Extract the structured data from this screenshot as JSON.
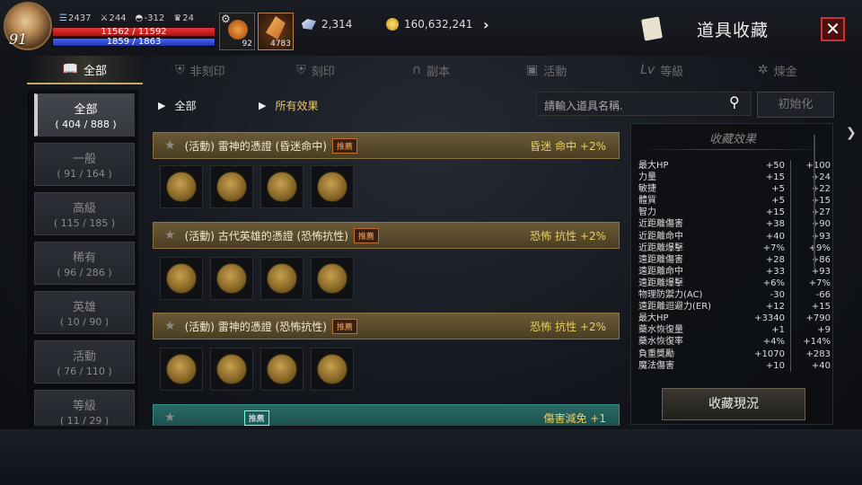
{
  "player": {
    "level": "91",
    "stat1": "2437",
    "stat2": "244",
    "stat3": "-312",
    "stat4": "24",
    "hp": "11562 / 11592",
    "mp": "1859 / 1863"
  },
  "slots": {
    "potion_count": "92",
    "feather_count": "4783"
  },
  "currency": {
    "crystal": "2,314",
    "gold": "160,632,241"
  },
  "window": {
    "title": "道具收藏",
    "close": "✕"
  },
  "tabs": [
    {
      "label": "全部",
      "icon": "book-icon"
    },
    {
      "label": "非刻印",
      "icon": "shield-icon"
    },
    {
      "label": "刻印",
      "icon": "shield-icon"
    },
    {
      "label": "副本",
      "icon": "portal-icon"
    },
    {
      "label": "活動",
      "icon": "gift-icon"
    },
    {
      "label": "等級",
      "icon": "level-icon"
    },
    {
      "label": "煉金",
      "icon": "alchemy-icon"
    }
  ],
  "nav": [
    {
      "label": "全部",
      "count": "( 404 / 888 )"
    },
    {
      "label": "一般",
      "count": "( 91 / 164 )"
    },
    {
      "label": "高級",
      "count": "( 115 / 185 )"
    },
    {
      "label": "稀有",
      "count": "( 96 / 286 )"
    },
    {
      "label": "英雄",
      "count": "( 10 / 90 )"
    },
    {
      "label": "活動",
      "count": "( 76 / 110 )"
    },
    {
      "label": "等級",
      "count": "( 11 / 29 )"
    }
  ],
  "filter": {
    "category": "全部",
    "effect": "所有效果",
    "search_placeholder": "請輸入道具名稱.",
    "reset": "初始化"
  },
  "collections": [
    {
      "name": "(活動) 雷神的憑證 (昏迷命中)",
      "badge": "推薦",
      "effect": "昏迷 命中 +2%"
    },
    {
      "name": "(活動) 古代英雄的憑證 (恐怖抗性)",
      "badge": "推薦",
      "effect": "恐怖 抗性 +2%"
    },
    {
      "name": "(活動) 雷神的憑證 (恐怖抗性)",
      "badge": "推薦",
      "effect": "恐怖 抗性 +2%"
    },
    {
      "name": "",
      "badge": "推薦",
      "effect": "傷害減免 +1"
    }
  ],
  "effects_panel": {
    "title": "收藏效果",
    "button": "收藏現況",
    "rows": [
      {
        "k": "最大HP",
        "a": "+50",
        "b": "+100"
      },
      {
        "k": "力量",
        "a": "+15",
        "b": "+24"
      },
      {
        "k": "敏捷",
        "a": "+5",
        "b": "+22"
      },
      {
        "k": "體質",
        "a": "+5",
        "b": "+15"
      },
      {
        "k": "智力",
        "a": "+15",
        "b": "+27"
      },
      {
        "k": "近距離傷害",
        "a": "+38",
        "b": "+90"
      },
      {
        "k": "近距離命中",
        "a": "+40",
        "b": "+93"
      },
      {
        "k": "近距離爆擊",
        "a": "+7%",
        "b": "+9%"
      },
      {
        "k": "遠距離傷害",
        "a": "+28",
        "b": "+86"
      },
      {
        "k": "遠距離命中",
        "a": "+33",
        "b": "+93"
      },
      {
        "k": "遠距離爆擊",
        "a": "+6%",
        "b": "+7%"
      },
      {
        "k": "物理防禦力(AC)",
        "a": "-30",
        "b": "-66"
      },
      {
        "k": "遠距離迴避力(ER)",
        "a": "+12",
        "b": "+15"
      },
      {
        "k": "最大HP",
        "a": "+3340",
        "b": "+790"
      },
      {
        "k": "藥水恢復量",
        "a": "+1",
        "b": "+9"
      },
      {
        "k": "藥水恢復率",
        "a": "+4%",
        "b": "+14%"
      },
      {
        "k": "負重獎勵",
        "a": "+1070",
        "b": "+283"
      },
      {
        "k": "魔法傷害",
        "a": "+10",
        "b": "+40"
      }
    ]
  }
}
